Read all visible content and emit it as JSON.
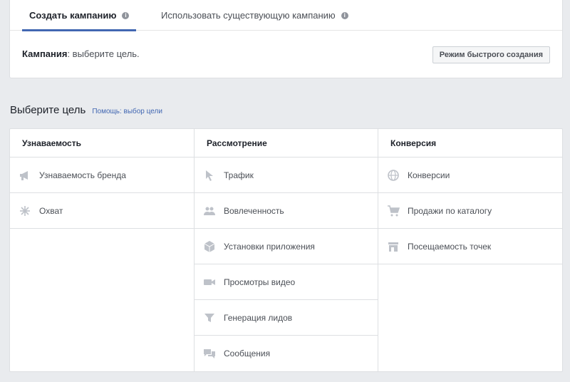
{
  "tabs": [
    {
      "label": "Создать кампанию",
      "active": true
    },
    {
      "label": "Использовать существующую кампанию",
      "active": false
    }
  ],
  "campaign": {
    "label": "Кампания",
    "text": ": выберите цель."
  },
  "quick_create_label": "Режим быстрого создания",
  "objective": {
    "title": "Выберите цель",
    "help": "Помощь: выбор цели"
  },
  "columns": [
    {
      "header": "Узнаваемость",
      "items": [
        {
          "label": "Узнаваемость бренда",
          "icon": "megaphone-icon"
        },
        {
          "label": "Охват",
          "icon": "reach-icon"
        }
      ]
    },
    {
      "header": "Рассмотрение",
      "items": [
        {
          "label": "Трафик",
          "icon": "cursor-icon"
        },
        {
          "label": "Вовлеченность",
          "icon": "people-icon"
        },
        {
          "label": "Установки приложения",
          "icon": "box-icon"
        },
        {
          "label": "Просмотры видео",
          "icon": "video-camera-icon"
        },
        {
          "label": "Генерация лидов",
          "icon": "funnel-icon"
        },
        {
          "label": "Сообщения",
          "icon": "chat-bubbles-icon"
        }
      ]
    },
    {
      "header": "Конверсия",
      "items": [
        {
          "label": "Конверсии",
          "icon": "globe-icon"
        },
        {
          "label": "Продажи по каталогу",
          "icon": "shopping-cart-icon"
        },
        {
          "label": "Посещаемость точек",
          "icon": "store-icon"
        }
      ]
    }
  ],
  "colors": {
    "accent": "#4267b2",
    "icon": "#bec2c9"
  }
}
